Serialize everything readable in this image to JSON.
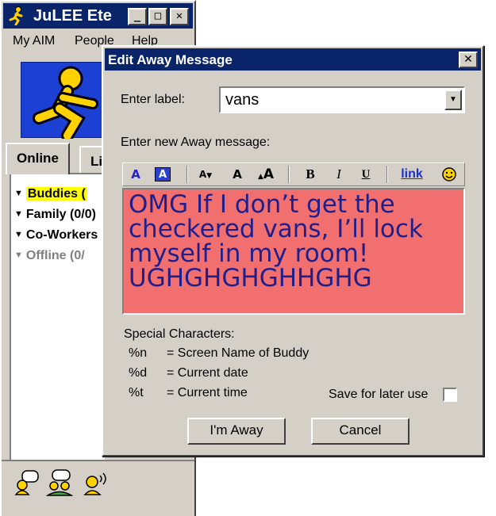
{
  "buddy_window": {
    "title": "JuLEE Ete",
    "title_buttons": {
      "minimize": "_",
      "maximize": "□",
      "close": "✕"
    },
    "menu": [
      "My AIM",
      "People",
      "Help"
    ],
    "tabs": [
      {
        "label": "Online"
      },
      {
        "label": "List Setup"
      }
    ],
    "groups": [
      {
        "label": "Buddies (",
        "selected": true
      },
      {
        "label": "Family (0/0)"
      },
      {
        "label": "Co-Workers"
      },
      {
        "label": "Offline (0/",
        "offline": true
      }
    ],
    "bottom_icons": [
      "im-icon",
      "chat-icon",
      "talk-icon"
    ]
  },
  "dialog": {
    "title": "Edit Away Message",
    "close_glyph": "✕",
    "label_prompt": "Enter label:",
    "label_value": "vans",
    "message_prompt": "Enter new Away message:",
    "toolbar": {
      "fg_color": "A",
      "bg_color": "A",
      "decrease_font": "A",
      "normal_font": "A",
      "increase_font": "A",
      "bold": "B",
      "italic": "I",
      "underline": "U",
      "link": "link"
    },
    "message_text": "OMG If I don’t get the checkered vans, I’ll lock myself in my room! UGHGHGHGHHGHG",
    "special_title": "Special Characters:",
    "special_chars": [
      {
        "code": "%n",
        "desc": "= Screen Name of Buddy"
      },
      {
        "code": "%d",
        "desc": "= Current date"
      },
      {
        "code": "%t",
        "desc": "= Current time"
      }
    ],
    "save_label": "Save for later use",
    "save_checked": false,
    "away_button": "I'm Away",
    "cancel_button": "Cancel"
  },
  "colors": {
    "titlebar": "#0a246a",
    "window_bg": "#d4d0c8",
    "message_bg": "#f26f6f",
    "message_text": "#1f1f8c",
    "selected_group": "#ffff00",
    "aim_yellow": "#ffd200"
  }
}
